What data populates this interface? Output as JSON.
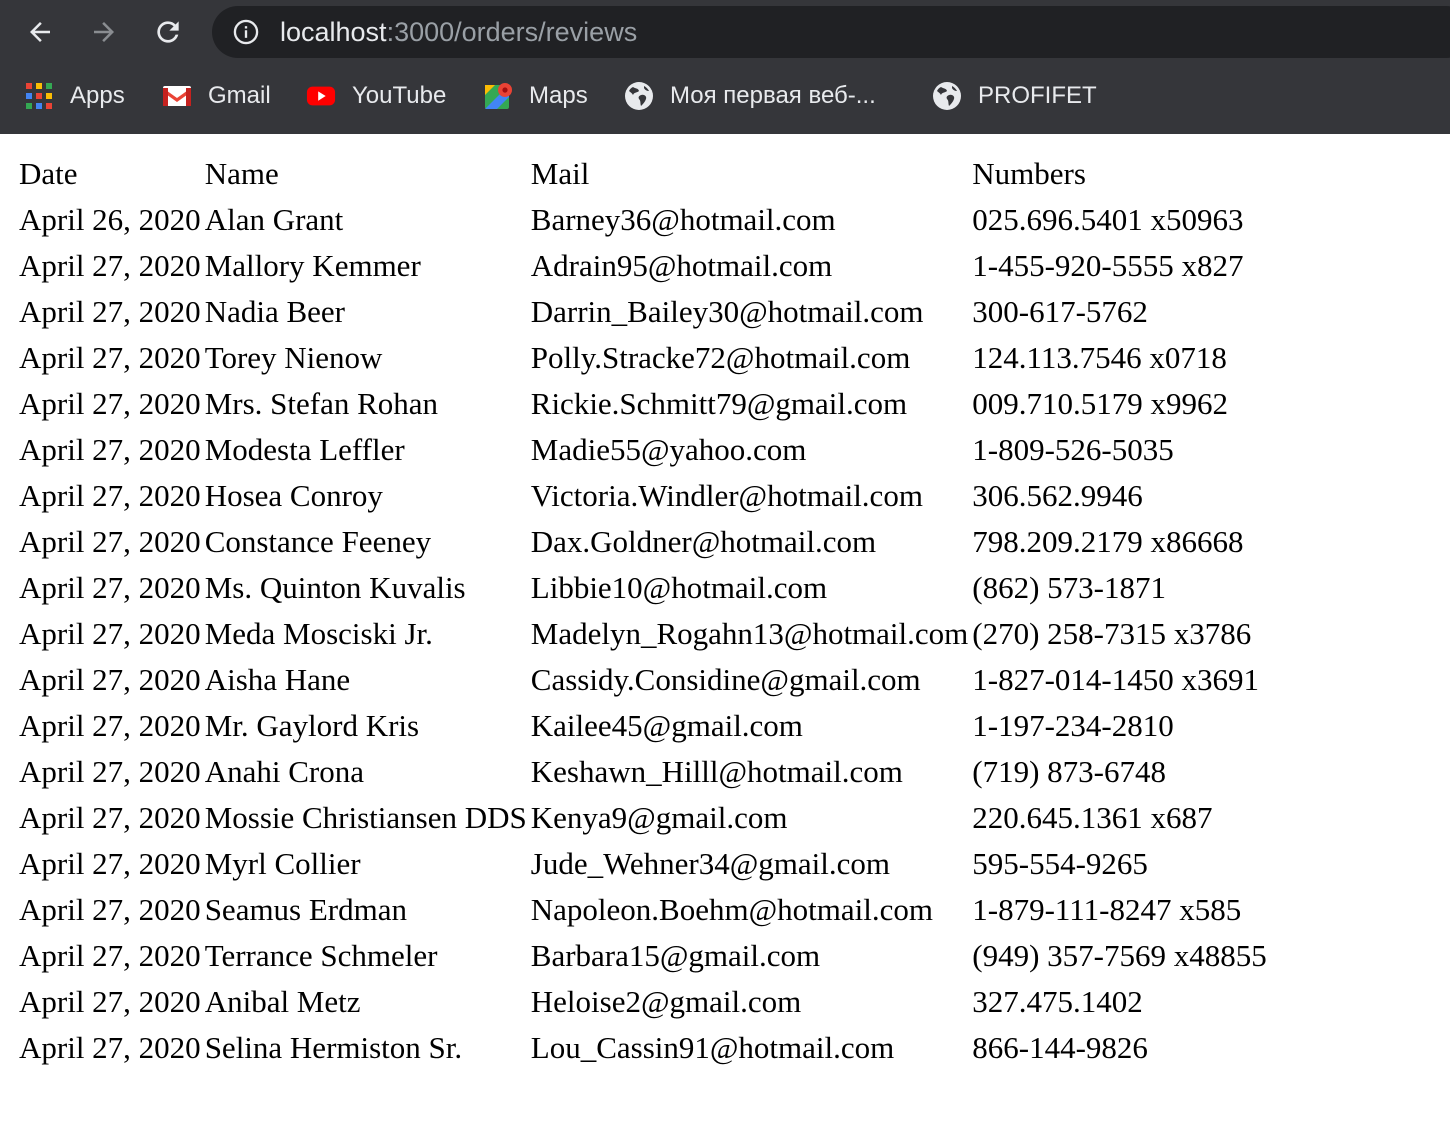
{
  "browser": {
    "url_host": "localhost",
    "url_path": ":3000/orders/reviews",
    "icons": {
      "back": "arrow-left-icon",
      "forward": "arrow-right-icon",
      "reload": "reload-icon",
      "info": "info-icon"
    },
    "colors": {
      "chrome_bg": "#35363a",
      "omnibox_bg": "#202124",
      "text": "#e8eaed",
      "muted": "#9aa0a6"
    }
  },
  "bookmarks": [
    {
      "label": "Apps",
      "icon": "apps-grid-icon"
    },
    {
      "label": "Gmail",
      "icon": "gmail-icon"
    },
    {
      "label": "YouTube",
      "icon": "youtube-icon"
    },
    {
      "label": "Maps",
      "icon": "maps-icon"
    },
    {
      "label": "Моя первая веб-...",
      "icon": "globe-icon"
    },
    {
      "label": "PROFIFET",
      "icon": "globe-icon"
    }
  ],
  "table": {
    "headers": [
      "Date",
      "Name",
      "Mail",
      "Numbers"
    ],
    "rows": [
      [
        "April 26, 2020",
        "Alan Grant",
        "Barney36@hotmail.com",
        "025.696.5401 x50963"
      ],
      [
        "April 27, 2020",
        "Mallory Kemmer",
        "Adrain95@hotmail.com",
        "1-455-920-5555 x827"
      ],
      [
        "April 27, 2020",
        "Nadia Beer",
        "Darrin_Bailey30@hotmail.com",
        "300-617-5762"
      ],
      [
        "April 27, 2020",
        "Torey Nienow",
        "Polly.Stracke72@hotmail.com",
        "124.113.7546 x0718"
      ],
      [
        "April 27, 2020",
        "Mrs. Stefan Rohan",
        "Rickie.Schmitt79@gmail.com",
        "009.710.5179 x9962"
      ],
      [
        "April 27, 2020",
        "Modesta Leffler",
        "Madie55@yahoo.com",
        "1-809-526-5035"
      ],
      [
        "April 27, 2020",
        "Hosea Conroy",
        "Victoria.Windler@hotmail.com",
        "306.562.9946"
      ],
      [
        "April 27, 2020",
        "Constance Feeney",
        "Dax.Goldner@hotmail.com",
        "798.209.2179 x86668"
      ],
      [
        "April 27, 2020",
        "Ms. Quinton Kuvalis",
        "Libbie10@hotmail.com",
        "(862) 573-1871"
      ],
      [
        "April 27, 2020",
        "Meda Mosciski Jr.",
        "Madelyn_Rogahn13@hotmail.com",
        "(270) 258-7315 x3786"
      ],
      [
        "April 27, 2020",
        "Aisha Hane",
        "Cassidy.Considine@gmail.com",
        "1-827-014-1450 x3691"
      ],
      [
        "April 27, 2020",
        "Mr. Gaylord Kris",
        "Kailee45@gmail.com",
        "1-197-234-2810"
      ],
      [
        "April 27, 2020",
        "Anahi Crona",
        "Keshawn_Hilll@hotmail.com",
        "(719) 873-6748"
      ],
      [
        "April 27, 2020",
        "Mossie Christiansen DDS",
        "Kenya9@gmail.com",
        "220.645.1361 x687"
      ],
      [
        "April 27, 2020",
        "Myrl Collier",
        "Jude_Wehner34@gmail.com",
        "595-554-9265"
      ],
      [
        "April 27, 2020",
        "Seamus Erdman",
        "Napoleon.Boehm@hotmail.com",
        "1-879-111-8247 x585"
      ],
      [
        "April 27, 2020",
        "Terrance Schmeler",
        "Barbara15@gmail.com",
        "(949) 357-7569 x48855"
      ],
      [
        "April 27, 2020",
        "Anibal Metz",
        "Heloise2@gmail.com",
        "327.475.1402"
      ],
      [
        "April 27, 2020",
        "Selina Hermiston Sr.",
        "Lou_Cassin91@hotmail.com",
        "866-144-9826"
      ]
    ]
  }
}
